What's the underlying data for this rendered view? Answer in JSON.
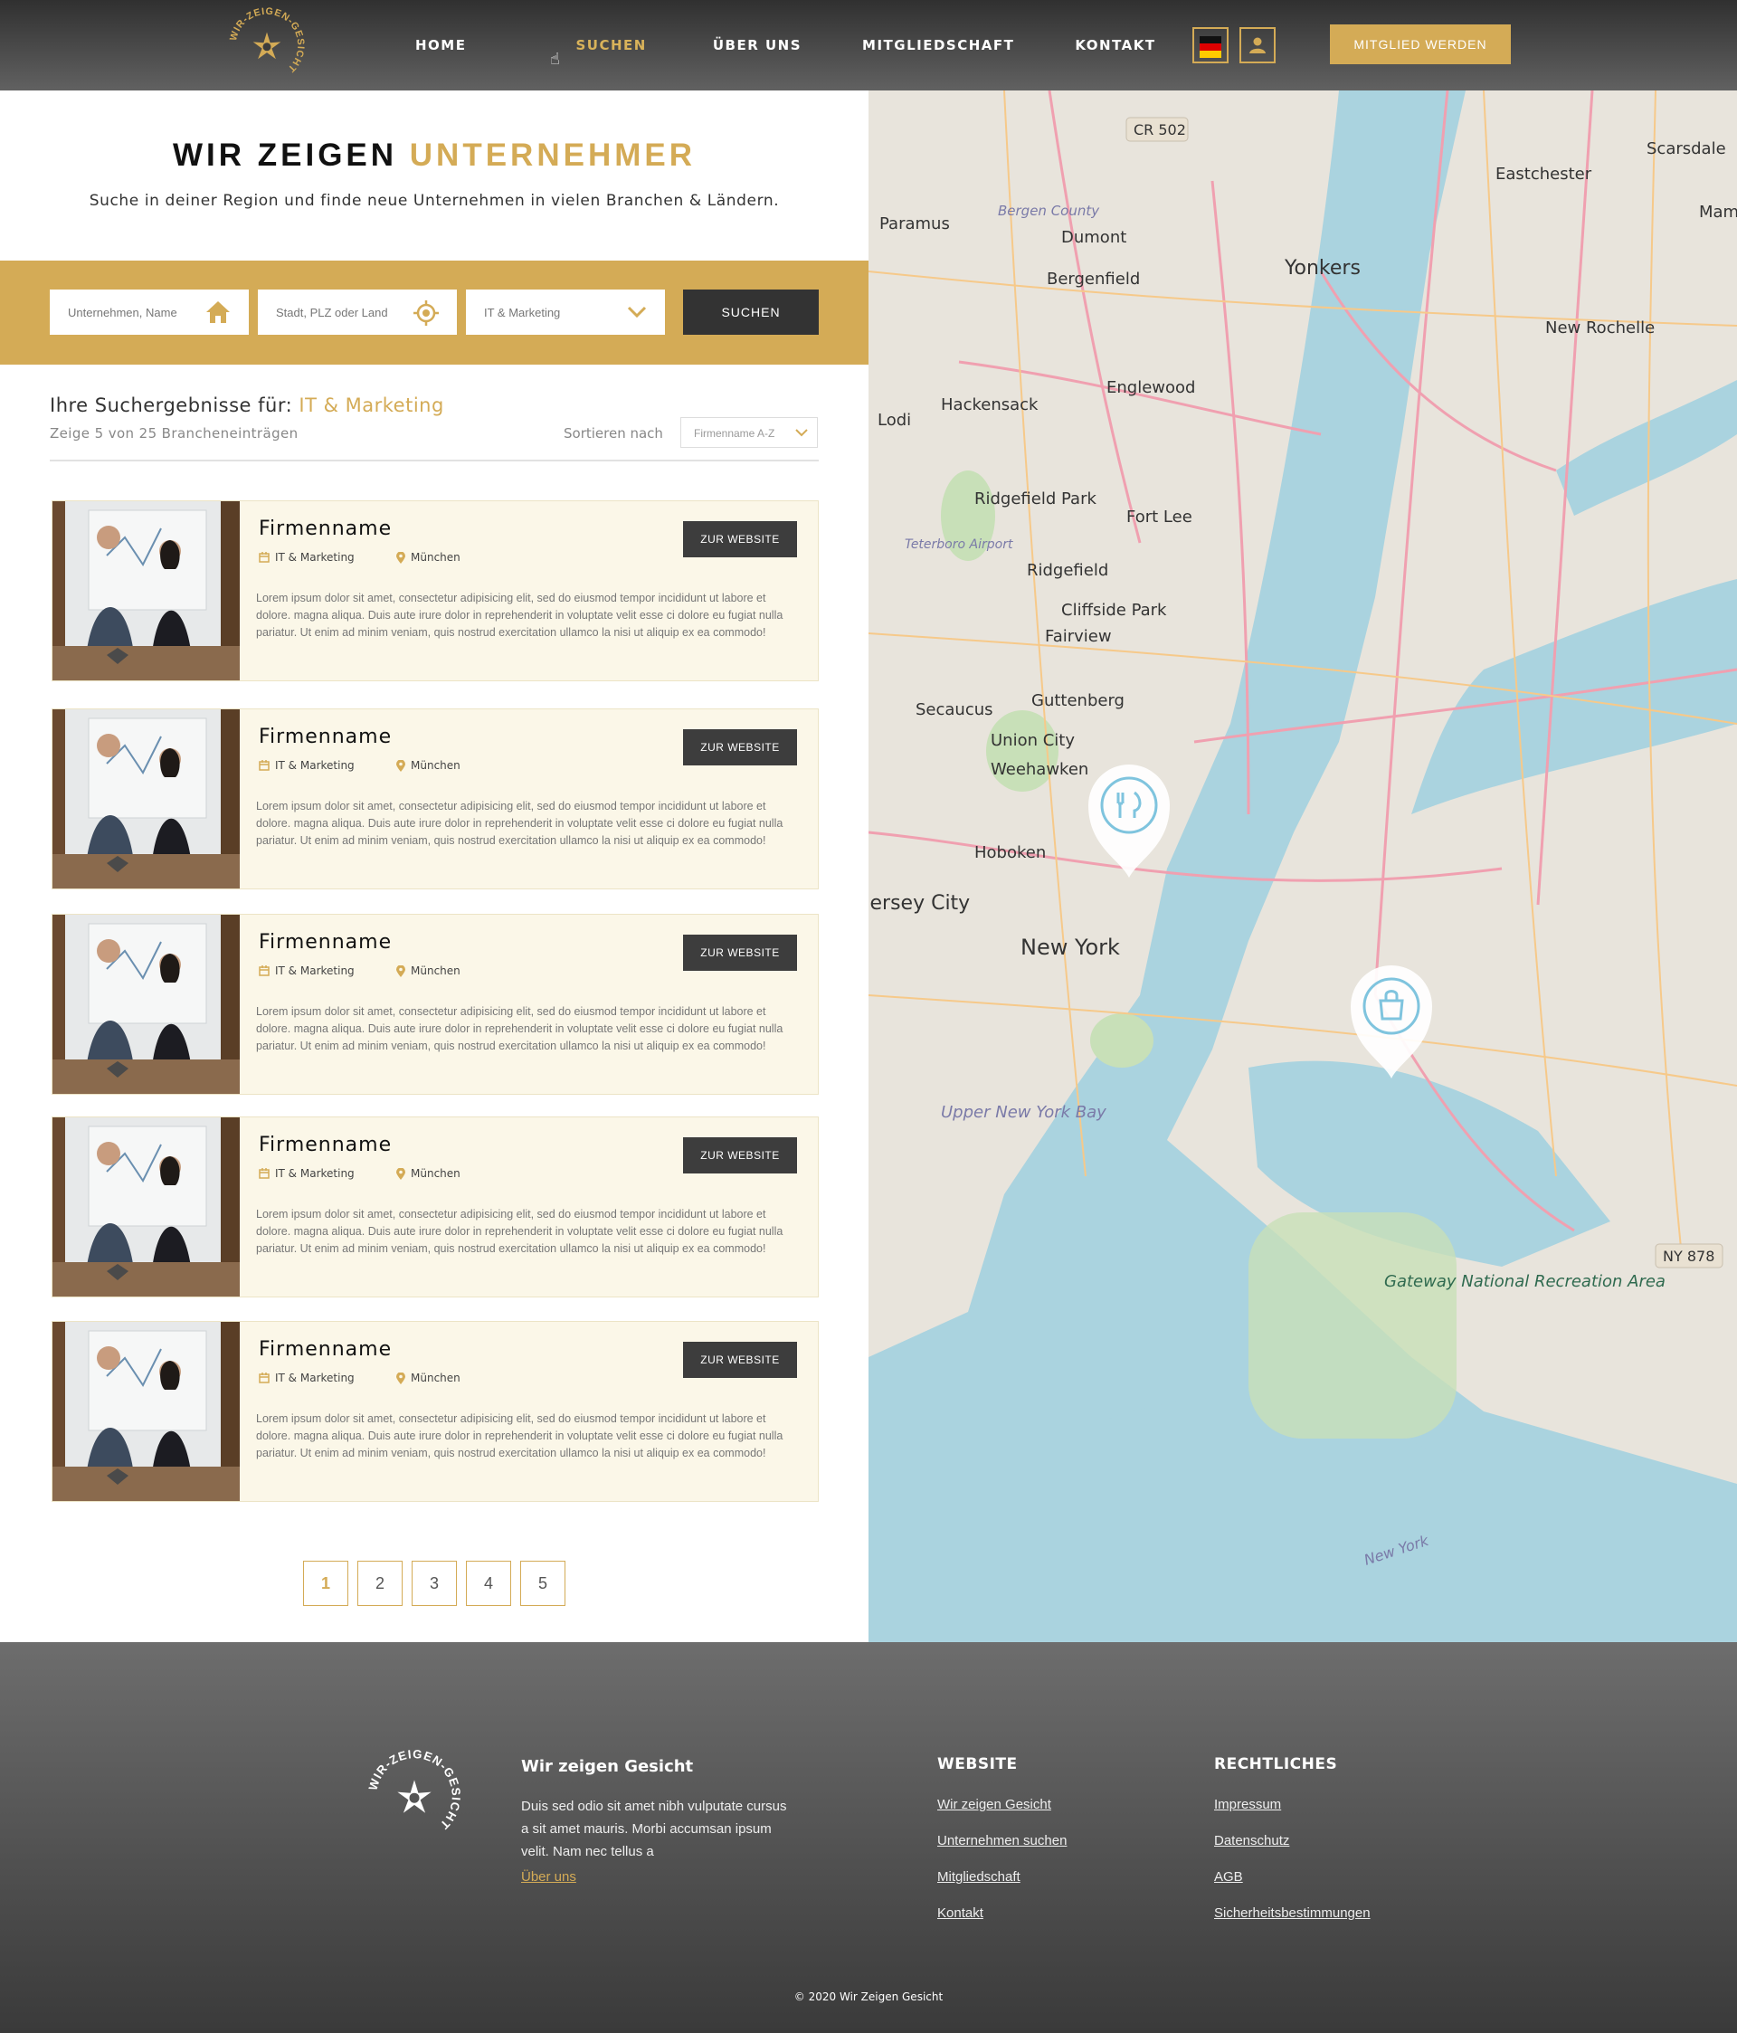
{
  "header": {
    "logo_text": "WIR-ZEIGEN-GESICHT",
    "nav": [
      {
        "label": "HOME",
        "active": false
      },
      {
        "label": "SUCHEN",
        "active": true
      },
      {
        "label": "ÜBER UNS",
        "active": false
      },
      {
        "label": "MITGLIEDSCHAFT",
        "active": false
      },
      {
        "label": "KONTAKT",
        "active": false
      }
    ],
    "cta_label": "MITGLIED WERDEN"
  },
  "hero": {
    "title_main": "WIR ZEIGEN",
    "title_accent": "UNTERNEHMER",
    "subtitle": "Suche in deiner Region und finde neue Unternehmen in vielen Branchen & Ländern."
  },
  "search": {
    "name_placeholder": "Unternehmen, Name",
    "location_placeholder": "Stadt, PLZ oder Land",
    "category_value": "IT & Marketing",
    "button_label": "SUCHEN"
  },
  "results": {
    "title_prefix": "Ihre Suchergebnisse für:",
    "title_query": "IT & Marketing",
    "count_text": "Zeige 5 von 25 Brancheneinträgen",
    "sort_label": "Sortieren nach",
    "sort_value": "Firmenname A-Z",
    "items": [
      {
        "name": "Firmenname",
        "category": "IT & Marketing",
        "city": "München",
        "button": "ZUR WEBSITE",
        "description": "Lorem ipsum dolor sit amet, consectetur adipisicing elit, sed do eiusmod tempor incididunt ut labore et dolore. magna aliqua. Duis aute irure dolor in reprehenderit in voluptate velit esse ci dolore eu fugiat nulla pariatur. Ut enim ad minim veniam, quis nostrud exercitation ullamco la nisi ut aliquip ex ea commodo!"
      },
      {
        "name": "Firmenname",
        "category": "IT & Marketing",
        "city": "München",
        "button": "ZUR WEBSITE",
        "description": "Lorem ipsum dolor sit amet, consectetur adipisicing elit, sed do eiusmod tempor incididunt ut labore et dolore. magna aliqua. Duis aute irure dolor in reprehenderit in voluptate velit esse ci dolore eu fugiat nulla pariatur. Ut enim ad minim veniam, quis nostrud exercitation ullamco la nisi ut aliquip ex ea commodo!"
      },
      {
        "name": "Firmenname",
        "category": "IT & Marketing",
        "city": "München",
        "button": "ZUR WEBSITE",
        "description": "Lorem ipsum dolor sit amet, consectetur adipisicing elit, sed do eiusmod tempor incididunt ut labore et dolore. magna aliqua. Duis aute irure dolor in reprehenderit in voluptate velit esse ci dolore eu fugiat nulla pariatur. Ut enim ad minim veniam, quis nostrud exercitation ullamco la nisi ut aliquip ex ea commodo!"
      },
      {
        "name": "Firmenname",
        "category": "IT & Marketing",
        "city": "München",
        "button": "ZUR WEBSITE",
        "description": "Lorem ipsum dolor sit amet, consectetur adipisicing elit, sed do eiusmod tempor incididunt ut labore et dolore. magna aliqua. Duis aute irure dolor in reprehenderit in voluptate velit esse ci dolore eu fugiat nulla pariatur. Ut enim ad minim veniam, quis nostrud exercitation ullamco la nisi ut aliquip ex ea commodo!"
      },
      {
        "name": "Firmenname",
        "category": "IT & Marketing",
        "city": "München",
        "button": "ZUR WEBSITE",
        "description": "Lorem ipsum dolor sit amet, consectetur adipisicing elit, sed do eiusmod tempor incididunt ut labore et dolore. magna aliqua. Duis aute irure dolor in reprehenderit in voluptate velit esse ci dolore eu fugiat nulla pariatur. Ut enim ad minim veniam, quis nostrud exercitation ullamco la nisi ut aliquip ex ea commodo!"
      }
    ]
  },
  "pagination": {
    "pages": [
      "1",
      "2",
      "3",
      "4",
      "5"
    ],
    "current": "1"
  },
  "map": {
    "labels": [
      "CR 502",
      "Scarsdale",
      "Eastchester",
      "Mamaroneck",
      "Paramus",
      "Bergen County",
      "Dumont",
      "Yonkers",
      "Bergenfield",
      "New Rochelle",
      "Englewood",
      "Hackensack",
      "Lodi",
      "Ridgefield Park",
      "Fort Lee",
      "Teterboro Airport",
      "Ridgefield",
      "Cliffside Park",
      "Fairview",
      "Secaucus",
      "Guttenberg",
      "Union City",
      "Weehawken",
      "Hoboken",
      "Jersey City",
      "New York",
      "Upper New York Bay",
      "Gateway National Recreation Area",
      "NY 878",
      "New York"
    ],
    "markers": [
      "restaurant-marker",
      "shopping-marker"
    ]
  },
  "footer": {
    "brand": "Wir zeigen Gesicht",
    "text": "Duis sed odio sit amet nibh vulputate cursus a sit amet mauris. Morbi accumsan ipsum velit. Nam nec tellus a",
    "about_link": "Über uns",
    "website_title": "WEBSITE",
    "website_links": [
      "Wir zeigen Gesicht",
      "Unternehmen suchen",
      "Mitgliedschaft",
      "Kontakt"
    ],
    "legal_title": "RECHTLICHES",
    "legal_links": [
      "Impressum",
      "Datenschutz",
      "AGB",
      "Sicherheitsbestimmungen"
    ],
    "copyright": "© 2020 Wir Zeigen Gesicht"
  },
  "colors": {
    "accent": "#d4ab56",
    "dark": "#333333",
    "card_bg": "#fbf7e8",
    "map_water": "#aad3df"
  }
}
